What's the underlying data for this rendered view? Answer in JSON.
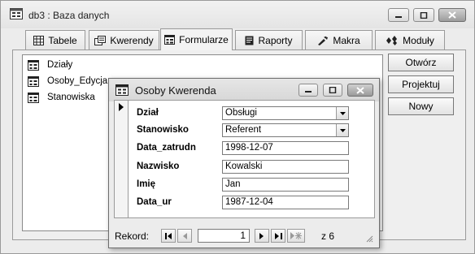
{
  "window": {
    "title": "db3 : Baza danych",
    "icon": "database-window-icon"
  },
  "tabs": [
    {
      "label": "Tabele",
      "icon": "table-icon",
      "active": false
    },
    {
      "label": "Kwerendy",
      "icon": "query-icon",
      "active": false
    },
    {
      "label": "Formularze",
      "icon": "form-icon",
      "active": true
    },
    {
      "label": "Raporty",
      "icon": "report-icon",
      "active": false
    },
    {
      "label": "Makra",
      "icon": "macro-icon",
      "active": false
    },
    {
      "label": "Moduły",
      "icon": "module-icon",
      "active": false
    }
  ],
  "objects": [
    {
      "label": "Działy",
      "icon": "form-icon"
    },
    {
      "label": "Osoby_Edycja",
      "icon": "form-icon"
    },
    {
      "label": "Stanowiska",
      "icon": "form-icon"
    }
  ],
  "actions": {
    "open": "Otwórz",
    "design": "Projektuj",
    "new": "Nowy"
  },
  "form": {
    "title": "Osoby Kwerenda",
    "fields": [
      {
        "label": "Dział",
        "value": "Obsługi",
        "type": "combo"
      },
      {
        "label": "Stanowisko",
        "value": "Referent",
        "type": "combo"
      },
      {
        "label": "Data_zatrudn",
        "value": "1998-12-07",
        "type": "text"
      },
      {
        "label": "Nazwisko",
        "value": "Kowalski",
        "type": "text"
      },
      {
        "label": "Imię",
        "value": "Jan",
        "type": "text"
      },
      {
        "label": "Data_ur",
        "value": "1987-12-04",
        "type": "text"
      }
    ]
  },
  "navigator": {
    "label": "Rekord:",
    "current": "1",
    "of_text": "z 6"
  }
}
